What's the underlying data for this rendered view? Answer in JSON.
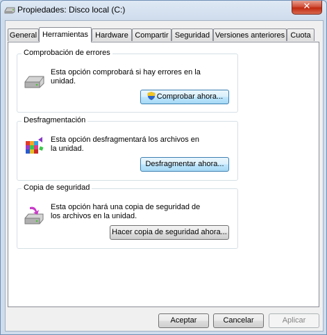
{
  "window": {
    "title": "Propiedades: Disco local (C:)",
    "close_label": "✕"
  },
  "tabs": [
    {
      "label": "General"
    },
    {
      "label": "Herramientas"
    },
    {
      "label": "Hardware"
    },
    {
      "label": "Compartir"
    },
    {
      "label": "Seguridad"
    },
    {
      "label": "Versiones anteriores"
    },
    {
      "label": "Cuota"
    }
  ],
  "active_tab": "Herramientas",
  "groups": {
    "error_check": {
      "title": "Comprobación de errores",
      "description": "Esta opción comprobará si hay errores en la unidad.",
      "button": "Comprobar ahora...",
      "icon": "hard-drive-icon"
    },
    "defrag": {
      "title": "Desfragmentación",
      "description": "Esta opción desfragmentará los archivos en la unidad.",
      "button": "Desfragmentar ahora...",
      "icon": "defrag-icon"
    },
    "backup": {
      "title": "Copia de seguridad",
      "description": "Esta opción hará una copia de seguridad de los archivos en la unidad.",
      "button": "Hacer copia de seguridad ahora...",
      "icon": "backup-icon"
    }
  },
  "footer": {
    "ok": "Aceptar",
    "cancel": "Cancelar",
    "apply": "Aplicar"
  }
}
